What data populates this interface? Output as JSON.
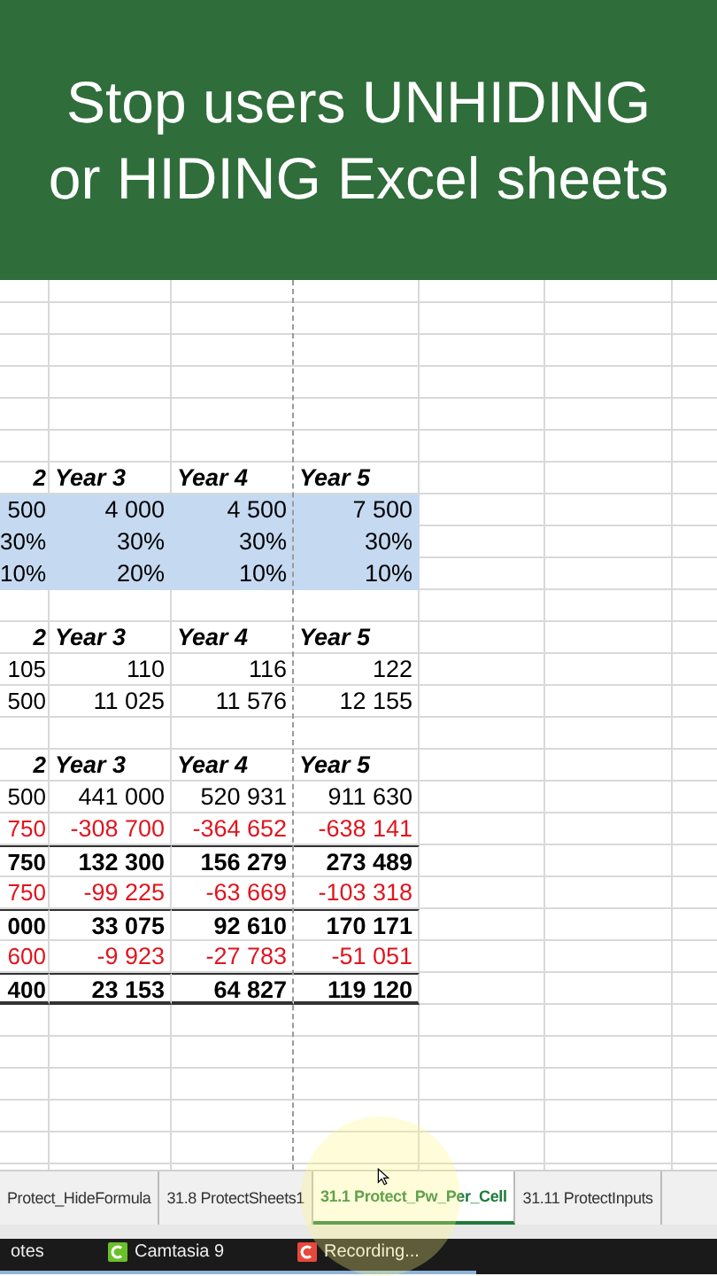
{
  "banner": {
    "title": "Stop users UNHIDING or HIDING Excel sheets"
  },
  "tables": [
    {
      "rows": [
        {
          "kind": "header",
          "cells": [
            "2",
            "Year 3",
            "Year 4",
            "Year 5"
          ]
        },
        {
          "kind": "input",
          "cells": [
            "500",
            "4 000",
            "4 500",
            "7 500"
          ]
        },
        {
          "kind": "input",
          "cells": [
            "30%",
            "30%",
            "30%",
            "30%"
          ]
        },
        {
          "kind": "input",
          "cells": [
            "10%",
            "20%",
            "10%",
            "10%"
          ]
        }
      ]
    },
    {
      "rows": [
        {
          "kind": "header",
          "cells": [
            "2",
            "Year 3",
            "Year 4",
            "Year 5"
          ]
        },
        {
          "kind": "plain",
          "cells": [
            "105",
            "110",
            "116",
            "122"
          ]
        },
        {
          "kind": "plain",
          "cells": [
            "500",
            "11 025",
            "11 576",
            "12 155"
          ]
        }
      ]
    },
    {
      "rows": [
        {
          "kind": "header",
          "cells": [
            "2",
            "Year 3",
            "Year 4",
            "Year 5"
          ]
        },
        {
          "kind": "plain",
          "cells": [
            "500",
            "441 000",
            "520 931",
            "911 630"
          ]
        },
        {
          "kind": "negative",
          "cells": [
            "750",
            "-308 700",
            "-364 652",
            "-638 141"
          ]
        },
        {
          "kind": "total",
          "cells": [
            "750",
            "132 300",
            "156 279",
            "273 489"
          ]
        },
        {
          "kind": "negative",
          "cells": [
            "750",
            "-99 225",
            "-63 669",
            "-103 318"
          ]
        },
        {
          "kind": "total",
          "cells": [
            "000",
            "33 075",
            "92 610",
            "170 171"
          ]
        },
        {
          "kind": "negative",
          "cells": [
            "600",
            "-9 923",
            "-27 783",
            "-51 051"
          ]
        },
        {
          "kind": "grand_total",
          "cells": [
            "400",
            "23 153",
            "64 827",
            "119 120"
          ]
        }
      ]
    }
  ],
  "sheet_tabs": [
    {
      "label": "Protect_HideFormula",
      "selected": false
    },
    {
      "label": "31.8 ProtectSheets1",
      "selected": false
    },
    {
      "label": "31.1 Protect_Pw_Per_Cell",
      "selected": true
    },
    {
      "label": "31.11 ProtectInputs",
      "selected": false
    }
  ],
  "taskbar": [
    {
      "label": "otes"
    },
    {
      "label": "Camtasia 9",
      "color": "#6bbf2a"
    },
    {
      "label": "Recording...",
      "color": "#e8473b"
    }
  ]
}
